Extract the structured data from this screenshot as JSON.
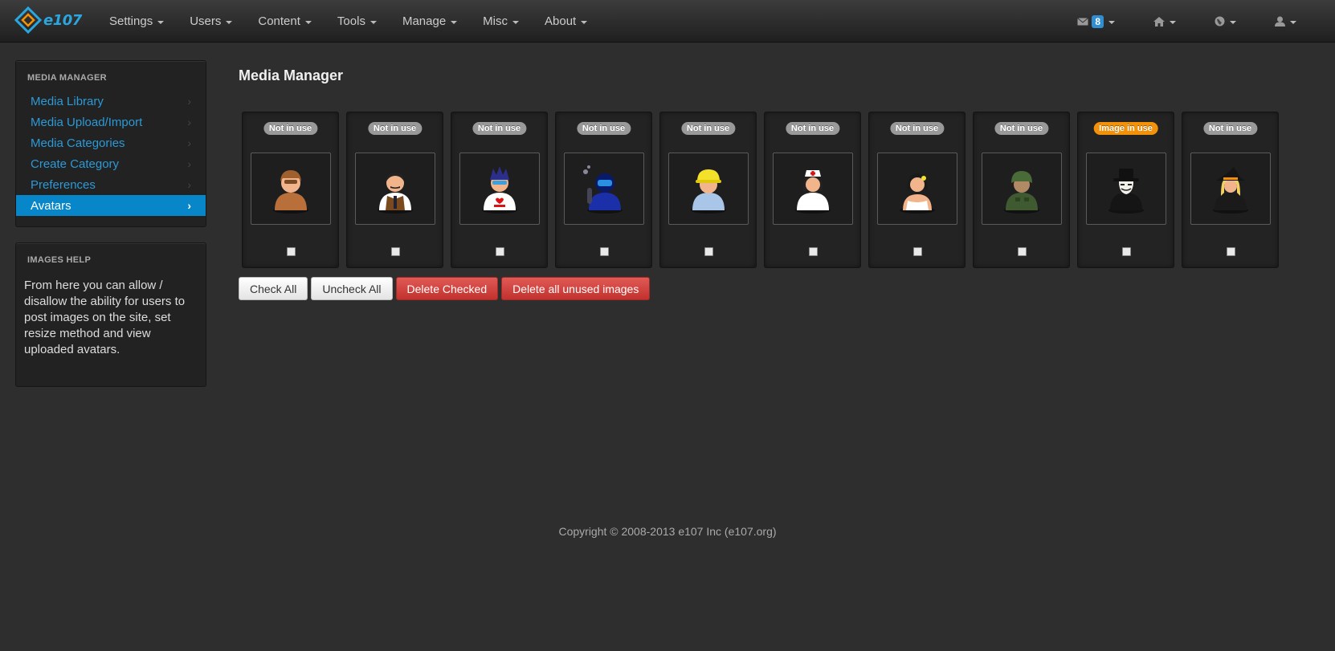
{
  "navbar": {
    "brand": "e107",
    "menus": [
      "Settings",
      "Users",
      "Content",
      "Tools",
      "Manage",
      "Misc",
      "About"
    ],
    "message_count": "8"
  },
  "sidebar": {
    "title": "MEDIA MANAGER",
    "items": [
      {
        "label": "Media Library"
      },
      {
        "label": "Media Upload/Import"
      },
      {
        "label": "Media Categories"
      },
      {
        "label": "Create Category"
      },
      {
        "label": "Preferences"
      },
      {
        "label": "Avatars",
        "active": true
      }
    ],
    "chevron": "›",
    "help_title": "IMAGES HELP",
    "help_text": "From here you can allow / disallow the ability for users to post images on the site, set resize method and view uploaded avatars."
  },
  "main": {
    "title": "Media Manager",
    "avatars": [
      {
        "status": "Not in use",
        "icon": "pilot-avatar-icon",
        "in_use": false,
        "checked": false
      },
      {
        "status": "Not in use",
        "icon": "businessman-avatar-icon",
        "in_use": false,
        "checked": false
      },
      {
        "status": "Not in use",
        "icon": "designer-avatar-icon",
        "in_use": false,
        "checked": false
      },
      {
        "status": "Not in use",
        "icon": "diver-avatar-icon",
        "in_use": false,
        "checked": false
      },
      {
        "status": "Not in use",
        "icon": "engineer-avatar-icon",
        "in_use": false,
        "checked": false
      },
      {
        "status": "Not in use",
        "icon": "nurse-avatar-icon",
        "in_use": false,
        "checked": false
      },
      {
        "status": "Not in use",
        "icon": "bride-avatar-icon",
        "in_use": false,
        "checked": false
      },
      {
        "status": "Not in use",
        "icon": "soldier-avatar-icon",
        "in_use": false,
        "checked": false
      },
      {
        "status": "Image in use",
        "icon": "masked-avatar-icon",
        "in_use": true,
        "checked": false
      },
      {
        "status": "Not in use",
        "icon": "witch-avatar-icon",
        "in_use": false,
        "checked": false
      }
    ],
    "buttons": {
      "check_all": "Check All",
      "uncheck_all": "Uncheck All",
      "delete_checked": "Delete Checked",
      "delete_unused": "Delete all unused images"
    }
  },
  "footer": {
    "copyright": "Copyright © 2008-2013 e107 Inc (e107.org)"
  },
  "colors": {
    "accent": "#0787c9",
    "link": "#2a9ad8",
    "in_use_badge": "#f39209",
    "danger": "#c2312d"
  }
}
